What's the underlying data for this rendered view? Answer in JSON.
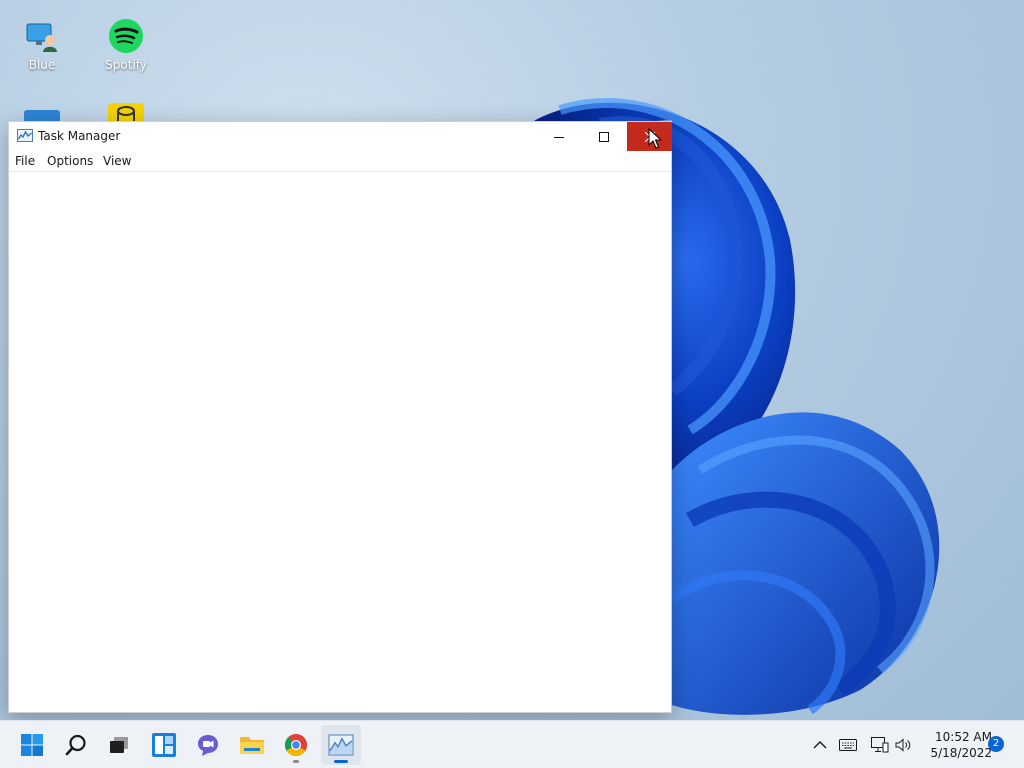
{
  "desktop": {
    "icons": [
      {
        "label": "Blue",
        "icon": "user-computer-icon"
      },
      {
        "label": "Spotify",
        "icon": "spotify-icon"
      }
    ]
  },
  "window": {
    "title": "Task Manager",
    "icon": "task-manager-icon",
    "menu": [
      "File",
      "Options",
      "View"
    ],
    "controls": {
      "minimize": "minimize-icon",
      "maximize": "maximize-icon",
      "close": "close-icon"
    },
    "close_hover_color": "#c42b1c"
  },
  "taskbar": {
    "items": [
      {
        "name": "start",
        "icon": "windows-start-icon",
        "running": false
      },
      {
        "name": "search",
        "icon": "search-icon",
        "running": false
      },
      {
        "name": "task-view",
        "icon": "task-view-icon",
        "running": false
      },
      {
        "name": "widgets",
        "icon": "widgets-icon",
        "running": false
      },
      {
        "name": "teams-chat",
        "icon": "teams-chat-icon",
        "running": false
      },
      {
        "name": "file-explorer",
        "icon": "folder-icon",
        "running": false
      },
      {
        "name": "chrome",
        "icon": "chrome-icon",
        "running": true
      },
      {
        "name": "task-manager",
        "icon": "task-manager-icon",
        "running": true,
        "active": true
      }
    ],
    "tray": {
      "icons": [
        "chevron-up-icon",
        "keyboard-icon",
        "network-icon",
        "volume-icon"
      ],
      "time": "10:52 AM",
      "date": "5/18/2022",
      "notification_count": "2"
    },
    "accent": "#0a64d6"
  }
}
